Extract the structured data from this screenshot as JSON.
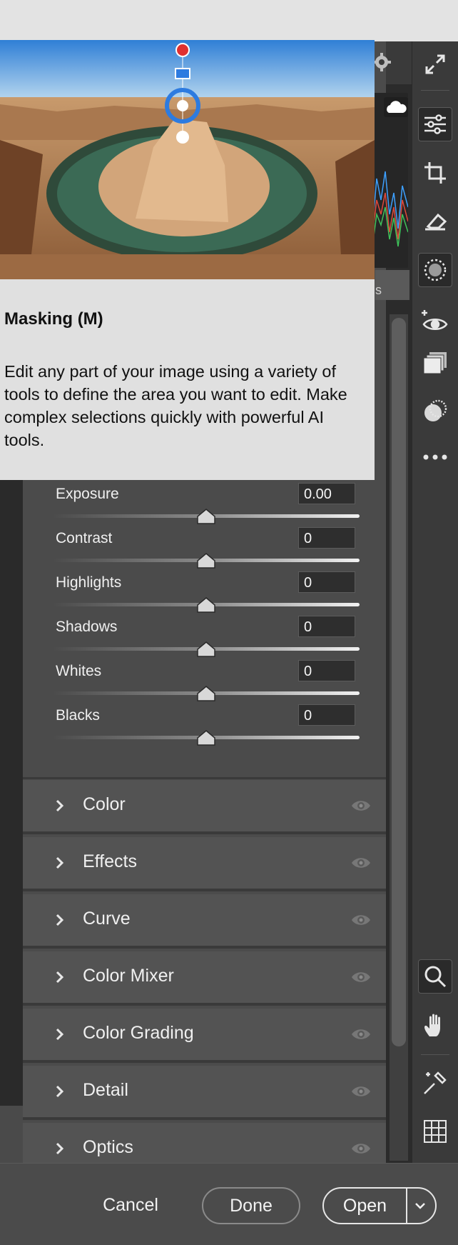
{
  "tooltip": {
    "title": "Masking (M)",
    "body": "Edit any part of your image using a variety of tools to define the area you want to edit. Make complex selections quickly with powerful AI tools."
  },
  "histogram_tab_fragment": "s",
  "sliders": [
    {
      "label": "Exposure",
      "value": "0.00",
      "level": 0.5
    },
    {
      "label": "Contrast",
      "value": "0",
      "level": 0.5
    },
    {
      "label": "Highlights",
      "value": "0",
      "level": 0.5
    },
    {
      "label": "Shadows",
      "value": "0",
      "level": 0.5
    },
    {
      "label": "Whites",
      "value": "0",
      "level": 0.5
    },
    {
      "label": "Blacks",
      "value": "0",
      "level": 0.5
    }
  ],
  "sections": [
    {
      "label": "Color"
    },
    {
      "label": "Effects"
    },
    {
      "label": "Curve"
    },
    {
      "label": "Color Mixer"
    },
    {
      "label": "Color Grading"
    },
    {
      "label": "Detail"
    },
    {
      "label": "Optics"
    }
  ],
  "rail_icons": [
    "edit-sliders-icon",
    "crop-icon",
    "eraser-icon",
    "masking-icon",
    "red-eye-icon",
    "presets-icon",
    "versions-icon",
    "more-icon",
    "zoom-icon",
    "hand-icon",
    "sampler-icon",
    "grid-icon"
  ],
  "footer": {
    "cancel": "Cancel",
    "done": "Done",
    "open": "Open"
  },
  "colors": {
    "panel": "#4b4b4b",
    "section": "#535353",
    "tooltip_bg": "#e0e0e0",
    "accent_blue": "#2d7be0"
  }
}
